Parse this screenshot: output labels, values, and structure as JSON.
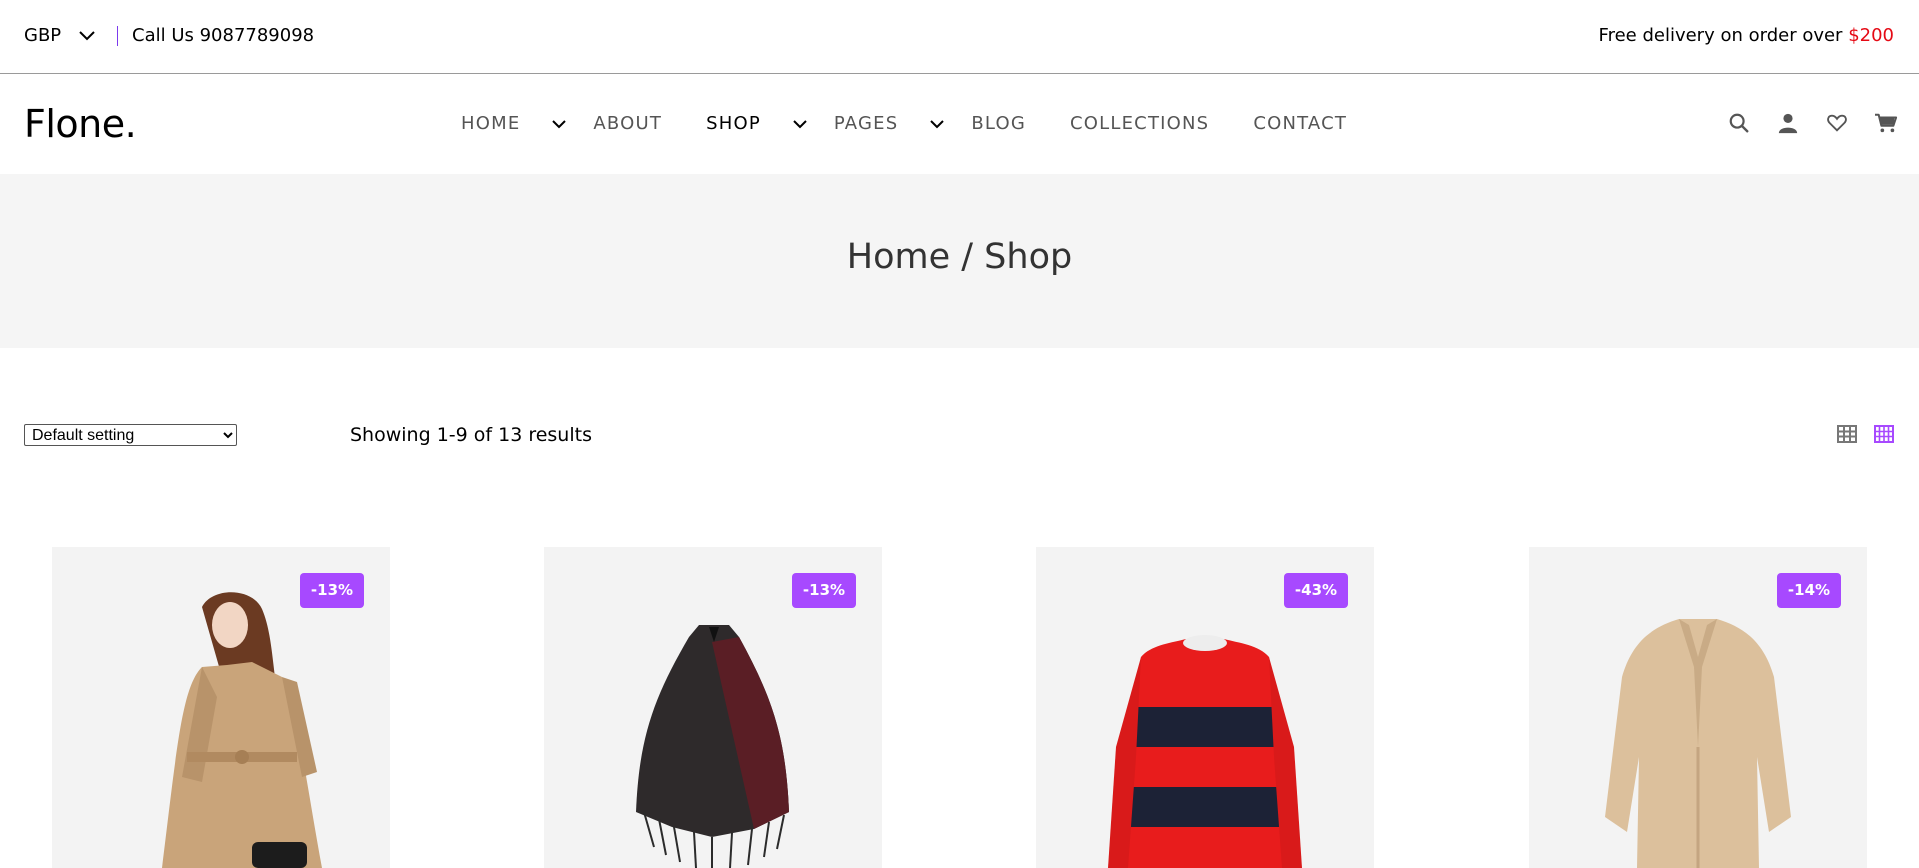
{
  "topbar": {
    "currency": "GBP",
    "call_label": "Call Us 9087789098",
    "delivery_text": "Free delivery on order over ",
    "delivery_amount": "$200"
  },
  "header": {
    "logo": "Flone.",
    "nav": [
      {
        "label": "HOME",
        "has_dropdown": true
      },
      {
        "label": "ABOUT",
        "has_dropdown": false
      },
      {
        "label": "SHOP",
        "has_dropdown": true,
        "active": true
      },
      {
        "label": "PAGES",
        "has_dropdown": true
      },
      {
        "label": "BLOG",
        "has_dropdown": false
      },
      {
        "label": "COLLECTIONS",
        "has_dropdown": false
      },
      {
        "label": "CONTACT",
        "has_dropdown": false
      }
    ],
    "icons": [
      "search-icon",
      "user-icon",
      "heart-icon",
      "cart-icon"
    ]
  },
  "breadcrumb": "Home / Shop",
  "toolbar": {
    "sort_selected": "Default setting",
    "results_text": "Showing 1-9 of 13 results",
    "view_icons": [
      "grid-view-icon",
      "grid-view-active-icon"
    ]
  },
  "products": [
    {
      "badge": "-13%",
      "image": "woman-trench-coat"
    },
    {
      "badge": "-13%",
      "image": "knit-poncho"
    },
    {
      "badge": "-43%",
      "image": "striped-sweater"
    },
    {
      "badge": "-14%",
      "image": "teddy-coat"
    }
  ],
  "colors": {
    "accent": "#a749ff",
    "price_red": "#e50914",
    "band_bg": "#f5f5f5",
    "card_bg": "#f3f3f3"
  }
}
